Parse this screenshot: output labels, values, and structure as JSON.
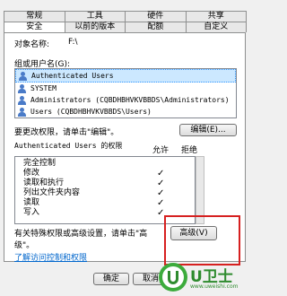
{
  "tabs_row1": [
    {
      "label": "常规"
    },
    {
      "label": "工具"
    },
    {
      "label": "硬件"
    },
    {
      "label": "共享"
    }
  ],
  "tabs_row2": [
    {
      "label": "安全",
      "active": true
    },
    {
      "label": "以前的版本"
    },
    {
      "label": "配额"
    },
    {
      "label": "自定义"
    }
  ],
  "object": {
    "label": "对象名称:",
    "value": "F:\\"
  },
  "group_label": "组或用户名(G):",
  "users": [
    {
      "name": "Authenticated Users",
      "selected": true
    },
    {
      "name": "SYSTEM"
    },
    {
      "name": "Administrators (CQBDHBHVKVBBDS\\Administrators)"
    },
    {
      "name": "Users (CQBDHBHVKVBBDS\\Users)"
    }
  ],
  "change_perm_text": "要更改权限，请单击\"编辑\"。",
  "edit_button": "编辑(E)...",
  "perm_for": "Authenticated Users 的权限",
  "allow_header": "允许",
  "deny_header": "拒绝",
  "permissions": [
    {
      "name": "完全控制",
      "allow": ""
    },
    {
      "name": "修改",
      "allow": "✓"
    },
    {
      "name": "读取和执行",
      "allow": "✓"
    },
    {
      "name": "列出文件夹内容",
      "allow": "✓"
    },
    {
      "name": "读取",
      "allow": "✓"
    },
    {
      "name": "写入",
      "allow": "✓"
    }
  ],
  "special_text_1": "有关特殊权限或高级设置，请单击\"高",
  "special_text_2": "级\"。",
  "advanced_button": "高级(V)",
  "learn_link": "了解访问控制和权限",
  "ok_button": "确定",
  "cancel_button": "取消",
  "watermark": {
    "brand": "U卫士",
    "url": "www.uweishi.com"
  }
}
